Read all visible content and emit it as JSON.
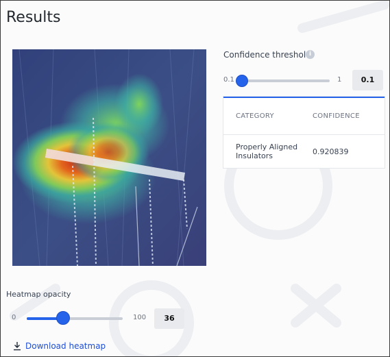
{
  "page": {
    "title": "Results"
  },
  "colors": {
    "accent": "#2563eb",
    "link": "#1d4ed8",
    "track": "#c9ced6"
  },
  "confidence_threshold": {
    "label": "Confidence threshold",
    "info_icon": "info-icon",
    "min_label": "0.1",
    "max_label": "1",
    "value": "0.1",
    "level_fraction": 0.0
  },
  "results_table": {
    "headers": {
      "category": "CATEGORY",
      "confidence": "CONFIDENCE"
    },
    "rows": [
      {
        "category": "Properly Aligned Insulators",
        "confidence": "0.920839"
      }
    ]
  },
  "heatmap_opacity": {
    "label": "Heatmap opacity",
    "min_label": "0",
    "max_label": "100",
    "value": "36",
    "level_fraction": 0.36
  },
  "download": {
    "label": "Download heatmap",
    "icon": "download-icon"
  }
}
